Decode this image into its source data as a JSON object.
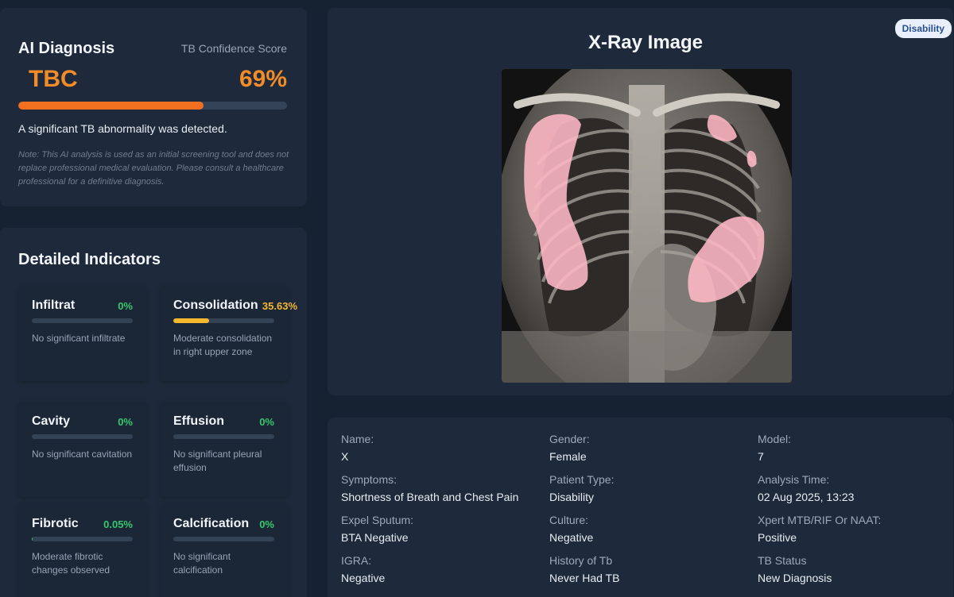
{
  "diagnosis": {
    "title": "AI Diagnosis",
    "confidence_label": "TB Confidence Score",
    "result": "TBC",
    "confidence": "69%",
    "confidence_fraction": 0.69,
    "message": "A significant TB abnormality was detected.",
    "note": "Note: This AI analysis is used as an initial screening tool and does not replace professional medical evaluation. Please consult a healthcare professional for a definitive diagnosis.",
    "accent_color": "#f28c28"
  },
  "indicators": {
    "title": "Detailed Indicators",
    "items": [
      {
        "name": "Infiltrat",
        "value": "0%",
        "fraction": 0,
        "desc": "No significant infiltrate"
      },
      {
        "name": "Consolidation",
        "value": "35.63%",
        "fraction": 0.3563,
        "desc": "Moderate consolidation in right upper zone"
      },
      {
        "name": "Cavity",
        "value": "0%",
        "fraction": 0,
        "desc": "No significant cavitation"
      },
      {
        "name": "Effusion",
        "value": "0%",
        "fraction": 0,
        "desc": "No significant pleural effusion"
      },
      {
        "name": "Fibrotic",
        "value": "0.05%",
        "fraction": 0.0005,
        "desc": "Moderate fibrotic changes observed"
      },
      {
        "name": "Calcification",
        "value": "0%",
        "fraction": 0,
        "desc": "No significant calcification"
      }
    ],
    "ok_color": "#35c96b",
    "warn_color": "#f5b82e"
  },
  "xray": {
    "title": "X-Ray Image",
    "badge": "Disability",
    "overlay_color": "#ffb8c6"
  },
  "patient": {
    "fields": [
      {
        "label": "Name:",
        "value": "X"
      },
      {
        "label": "Gender:",
        "value": "Female"
      },
      {
        "label": "Model:",
        "value": "7"
      },
      {
        "label": "Symptoms:",
        "value": "Shortness of Breath and Chest Pain"
      },
      {
        "label": "Patient Type:",
        "value": "Disability"
      },
      {
        "label": "Analysis Time:",
        "value": "02 Aug 2025, 13:23"
      },
      {
        "label": "Expel Sputum:",
        "value": "BTA Negative"
      },
      {
        "label": "Culture:",
        "value": "Negative"
      },
      {
        "label": "Xpert MTB/RIF Or NAAT:",
        "value": "Positive"
      },
      {
        "label": "IGRA:",
        "value": "Negative"
      },
      {
        "label": "History of Tb",
        "value": "Never Had TB"
      },
      {
        "label": "TB Status",
        "value": "New Diagnosis"
      }
    ]
  }
}
